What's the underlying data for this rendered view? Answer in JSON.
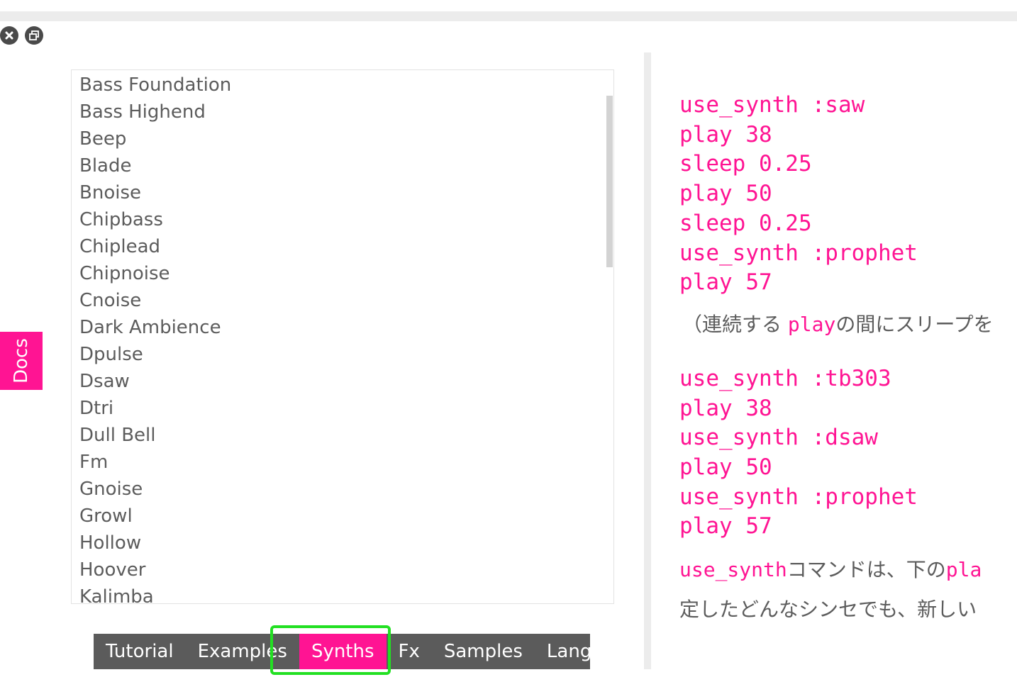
{
  "synths": [
    "Bass Foundation",
    "Bass Highend",
    "Beep",
    "Blade",
    "Bnoise",
    "Chipbass",
    "Chiplead",
    "Chipnoise",
    "Cnoise",
    "Dark Ambience",
    "Dpulse",
    "Dsaw",
    "Dtri",
    "Dull Bell",
    "Fm",
    "Gnoise",
    "Growl",
    "Hollow",
    "Hoover",
    "Kalimba"
  ],
  "side_tab": {
    "label": "Docs"
  },
  "tabs": [
    "Tutorial",
    "Examples",
    "Synths",
    "Fx",
    "Samples",
    "Lang"
  ],
  "active_tab": "Synths",
  "code1": [
    "use_synth :saw",
    "play 38",
    "sleep 0.25",
    "play 50",
    "sleep 0.25",
    "use_synth :prophet",
    "play 57"
  ],
  "para1": {
    "prefix": "（連続する ",
    "kw": "play",
    "suffix": "の間にスリープを"
  },
  "code2": [
    "use_synth :tb303",
    "play 38",
    "use_synth :dsaw",
    "play 50",
    "use_synth :prophet",
    "play 57"
  ],
  "para2": {
    "kw": "use_synth",
    "text": "コマンドは、下の",
    "kw2": "pla"
  },
  "para3": {
    "text": "定したどんなシンセでも、新しい"
  },
  "colors": {
    "accent": "#ff1493",
    "tabbar": "#5b5b5b",
    "highlight": "#22e022",
    "text": "#5c5c5c"
  },
  "icons": {
    "close": "close-icon",
    "restore": "restore-icon"
  }
}
